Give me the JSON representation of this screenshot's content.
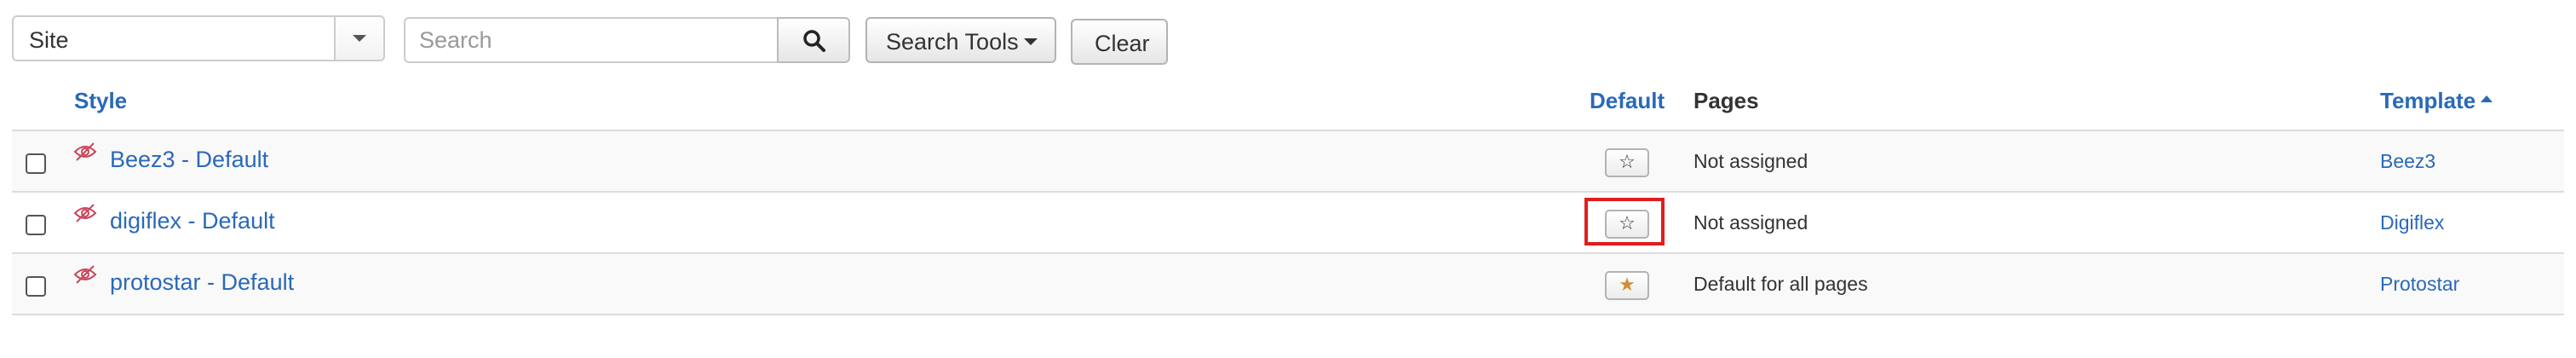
{
  "toolbar": {
    "site_select": {
      "value": "Site"
    },
    "search": {
      "placeholder": "Search",
      "value": ""
    },
    "search_tools_label": "Search Tools",
    "clear_label": "Clear"
  },
  "table": {
    "headers": {
      "style": "Style",
      "default": "Default",
      "pages": "Pages",
      "template": "Template"
    },
    "sort": {
      "column": "template",
      "direction": "ascending"
    },
    "rows": [
      {
        "style": "Beez3 - Default",
        "default": false,
        "pages": "Not assigned",
        "template": "Beez3"
      },
      {
        "style": "digiflex - Default",
        "default": false,
        "pages": "Not assigned",
        "template": "Digiflex",
        "highlighted": true
      },
      {
        "style": "protostar - Default",
        "default": true,
        "pages": "Default for all pages",
        "template": "Protostar"
      }
    ]
  },
  "icons": {
    "search_button": "search-icon",
    "unpublished_status": "eye-slash-icon",
    "default_off": "star-outline-icon",
    "default_on": "star-filled-icon"
  },
  "colors": {
    "link": "#2a69b8",
    "default_star": "#d08f3a",
    "highlight": "#e11d1d",
    "status_icon": "#c9475a"
  }
}
